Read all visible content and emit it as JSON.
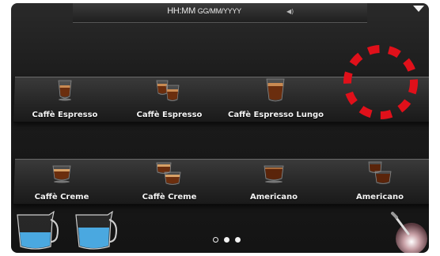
{
  "status_bar": {
    "time": "HH:MM",
    "date": "GG/MM/YYYY",
    "volume_icon": "speaker-icon",
    "menu_icon": "chevron-down-icon"
  },
  "row1": [
    {
      "label": "Caffè Espresso",
      "icon": "espresso-cup-icon"
    },
    {
      "label": "Caffè Espresso",
      "icon": "double-espresso-cup-icon"
    },
    {
      "label": "Caffè Espresso Lungo",
      "icon": "espresso-lungo-cup-icon"
    }
  ],
  "row2": [
    {
      "label": "Caffè Creme",
      "icon": "creme-cup-icon"
    },
    {
      "label": "Caffè Creme",
      "icon": "double-creme-cup-icon"
    },
    {
      "label": "Americano",
      "icon": "americano-cup-icon"
    },
    {
      "label": "Americano",
      "icon": "double-americano-cup-icon"
    }
  ],
  "pagination": {
    "pages": 3,
    "current": 2
  },
  "bottom": {
    "left_icons": [
      "milk-pitcher-icon",
      "milk-pitcher-icon"
    ],
    "right_icon": "steam-wand-icon"
  },
  "highlight": {
    "color": "#e0101a",
    "shape": "dashed-circle"
  }
}
